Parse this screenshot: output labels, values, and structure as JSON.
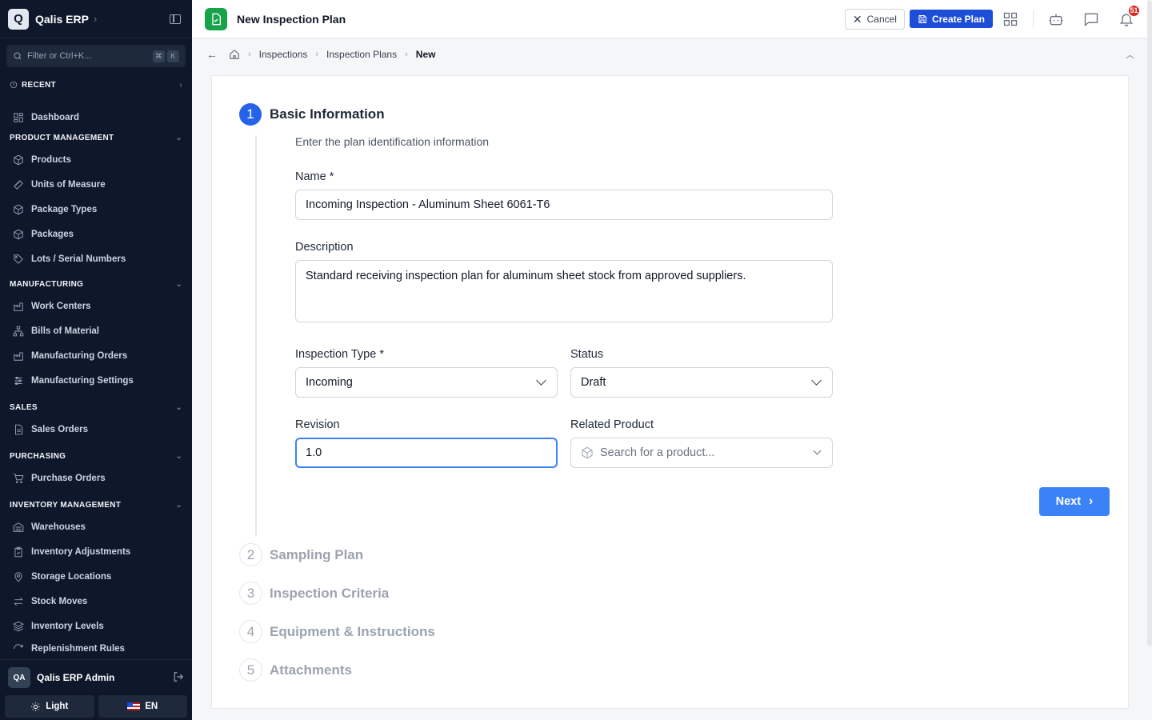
{
  "app": {
    "name": "Qalis ERP",
    "logo_letter": "Q"
  },
  "sidebar": {
    "filter_placeholder": "Filter or Ctrl+K...",
    "kbd": [
      "⌘",
      "K"
    ],
    "recent_label": "RECENT",
    "dashboard": "Dashboard",
    "sections": [
      {
        "title": "PRODUCT MANAGEMENT",
        "items": [
          "Products",
          "Units of Measure",
          "Package Types",
          "Packages",
          "Lots / Serial Numbers"
        ]
      },
      {
        "title": "MANUFACTURING",
        "items": [
          "Work Centers",
          "Bills of Material",
          "Manufacturing Orders",
          "Manufacturing Settings"
        ]
      },
      {
        "title": "SALES",
        "items": [
          "Sales Orders"
        ]
      },
      {
        "title": "PURCHASING",
        "items": [
          "Purchase Orders"
        ]
      },
      {
        "title": "INVENTORY MANAGEMENT",
        "items": [
          "Warehouses",
          "Inventory Adjustments",
          "Storage Locations",
          "Stock Moves",
          "Inventory Levels",
          "Replenishment Rules"
        ]
      }
    ],
    "user": {
      "initials": "QA",
      "name": "Qalis ERP Admin"
    },
    "theme_label": "Light",
    "lang_label": "EN"
  },
  "topbar": {
    "title": "New Inspection Plan",
    "cancel_label": "Cancel",
    "create_label": "Create Plan",
    "notification_count": "51"
  },
  "breadcrumb": {
    "items": [
      "Inspections",
      "Inspection Plans"
    ],
    "current": "New"
  },
  "form": {
    "step1": {
      "number": "1",
      "title": "Basic Information",
      "subtitle": "Enter the plan identification information"
    },
    "name_label": "Name *",
    "name_value": "Incoming Inspection - Aluminum Sheet 6061-T6",
    "description_label": "Description",
    "description_value": "Standard receiving inspection plan for aluminum sheet stock from approved suppliers.",
    "inspection_type_label": "Inspection Type *",
    "inspection_type_value": "Incoming",
    "status_label": "Status",
    "status_value": "Draft",
    "revision_label": "Revision",
    "revision_value": "1.0",
    "related_product_label": "Related Product",
    "related_product_placeholder": "Search for a product...",
    "next_label": "Next",
    "steps": [
      {
        "number": "2",
        "title": "Sampling Plan"
      },
      {
        "number": "3",
        "title": "Inspection Criteria"
      },
      {
        "number": "4",
        "title": "Equipment & Instructions"
      },
      {
        "number": "5",
        "title": "Attachments"
      }
    ]
  },
  "colors": {
    "sidebar_bg": "#0f172a",
    "primary": "#1d4ed8",
    "accent_blue": "#3b82f6",
    "doc_badge": "#16a34a",
    "notification": "#dc2626"
  }
}
